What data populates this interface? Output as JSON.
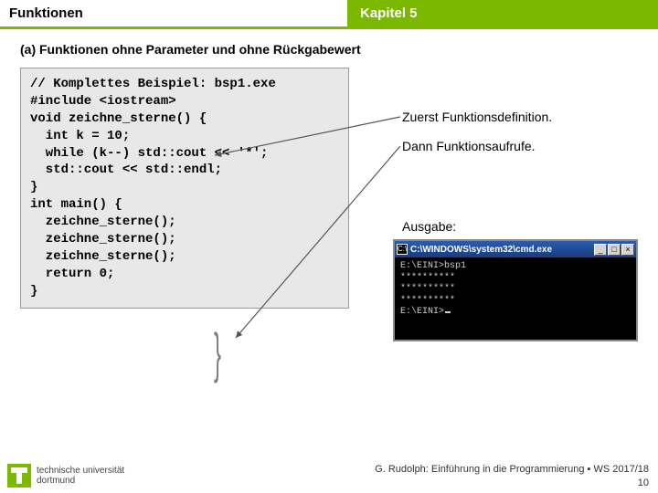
{
  "header": {
    "left": "Funktionen",
    "right": "Kapitel 5"
  },
  "subtitle": "(a) Funktionen ohne Parameter und ohne Rückgabewert",
  "code": {
    "l0": "// Komplettes Beispiel: bsp1.exe",
    "l1": "",
    "l2": "#include <iostream>",
    "l3": "",
    "l4": "void zeichne_sterne() {",
    "l5": "  int k = 10;",
    "l6": "  while (k--) std::cout << '*';",
    "l7": "  std::cout << std::endl;",
    "l8": "}",
    "l9": "",
    "l10": "int main() {",
    "l11": "",
    "l12": "  zeichne_sterne();",
    "l13": "  zeichne_sterne();",
    "l14": "  zeichne_sterne();",
    "l15": "",
    "l16": "  return 0;",
    "l17": "",
    "l18": "}"
  },
  "annotations": {
    "a1": "Zuerst Funktionsdefinition.",
    "a2": "Dann Funktionsaufrufe.",
    "a3": "Ausgabe:"
  },
  "cmd": {
    "title": "C:\\WINDOWS\\system32\\cmd.exe",
    "icon": "C:\\",
    "btn_min": "_",
    "btn_max": "□",
    "btn_close": "×",
    "r0": "E:\\EINI>bsp1",
    "r1": "**********",
    "r2": "**********",
    "r3": "**********",
    "r4": "",
    "r5": "E:\\EINI>"
  },
  "footer": {
    "line1": "G. Rudolph: Einführung in die Programmierung ▪ WS 2017/18",
    "line2": "10"
  },
  "logo": {
    "l1": "technische universität",
    "l2": "dortmund"
  }
}
